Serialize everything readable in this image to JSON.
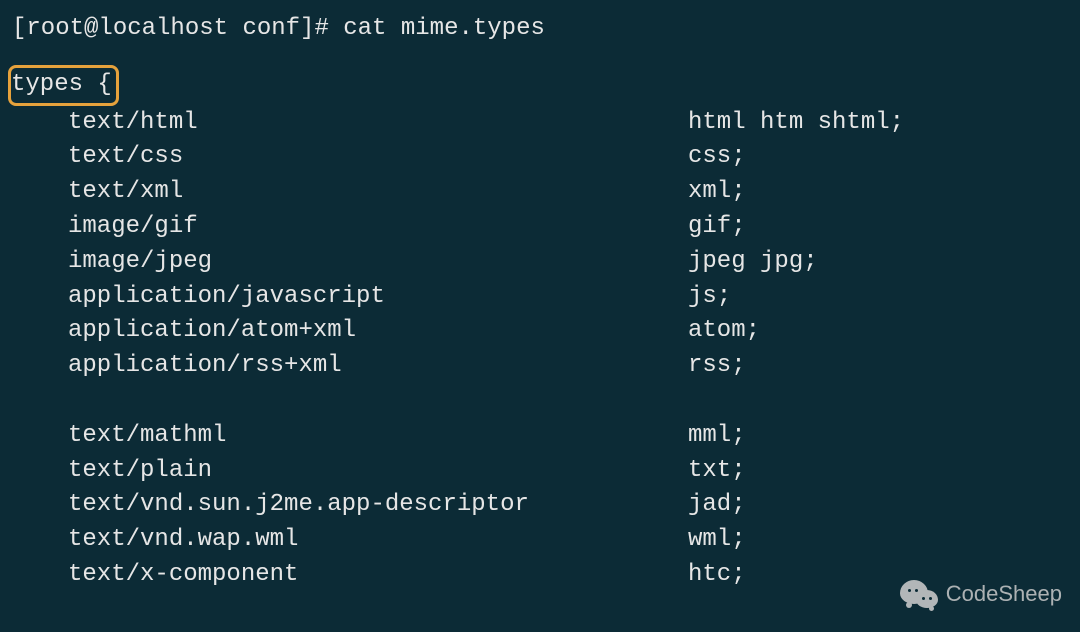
{
  "prompt": "[root@localhost conf]# cat mime.types",
  "types_open": "types {",
  "group1": [
    {
      "mime": "text/html",
      "ext": "html htm shtml;"
    },
    {
      "mime": "text/css",
      "ext": "css;"
    },
    {
      "mime": "text/xml",
      "ext": "xml;"
    },
    {
      "mime": "image/gif",
      "ext": "gif;"
    },
    {
      "mime": "image/jpeg",
      "ext": "jpeg jpg;"
    },
    {
      "mime": "application/javascript",
      "ext": "js;"
    },
    {
      "mime": "application/atom+xml",
      "ext": "atom;"
    },
    {
      "mime": "application/rss+xml",
      "ext": "rss;"
    }
  ],
  "group2": [
    {
      "mime": "text/mathml",
      "ext": "mml;"
    },
    {
      "mime": "text/plain",
      "ext": "txt;"
    },
    {
      "mime": "text/vnd.sun.j2me.app-descriptor",
      "ext": "jad;"
    },
    {
      "mime": "text/vnd.wap.wml",
      "ext": "wml;"
    },
    {
      "mime": "text/x-component",
      "ext": "htc;"
    }
  ],
  "watermark": "CodeSheep",
  "colors": {
    "background": "#0c2b36",
    "text": "#e6e6e6",
    "highlight_border": "#e6a23c"
  }
}
